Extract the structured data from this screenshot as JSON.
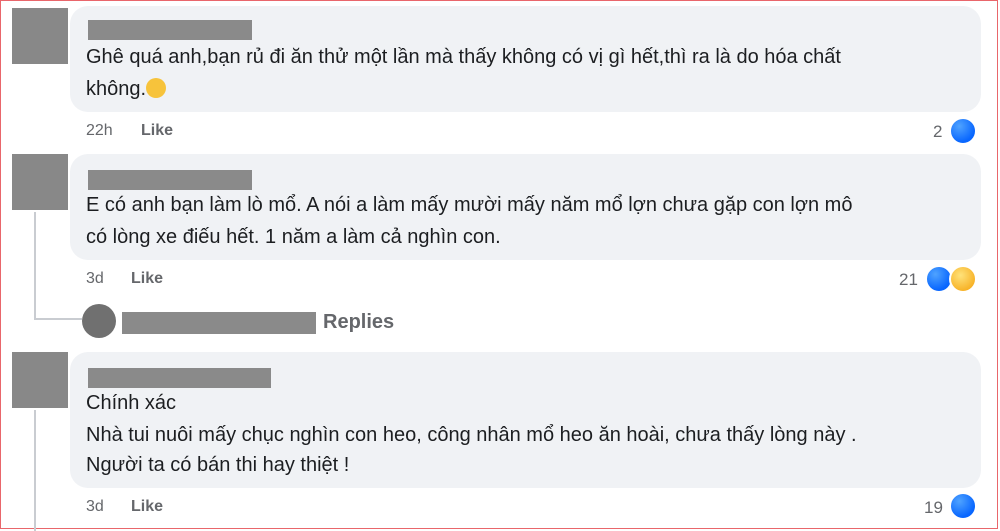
{
  "comments": [
    {
      "text_line1": "Ghê quá anh,bạn rủ đi ăn thử một lần mà thấy không có vị gì hết,thì ra là do hóa chất",
      "text_line2": "không.",
      "time": "22h",
      "like_label": "Like",
      "reaction_count": "2",
      "reactions": [
        "like-icon"
      ]
    },
    {
      "text_line1": "E có anh bạn làm lò mổ. A nói a làm mấy mười mấy năm mổ lợn chưa gặp con lợn mô",
      "text_line2": "có lòng xe điếu hết. 1 năm a làm cả nghìn con.",
      "time": "3d",
      "like_label": "Like",
      "reaction_count": "21",
      "reactions": [
        "like-icon",
        "haha-icon"
      ]
    },
    {
      "text_line1": "Chính xác",
      "text_line2": "Nhà tui nuôi mấy chục nghìn con heo, công nhân mổ heo ăn hoài, chưa thấy lòng này .",
      "text_line3": "Người ta có bán thi hay thiệt !",
      "time": "3d",
      "like_label": "Like",
      "reaction_count": "19",
      "reactions": [
        "like-icon"
      ]
    }
  ],
  "replies_label": "Replies",
  "colors": {
    "like_blue": "#0866ff",
    "bubble_bg": "#f0f2f5",
    "meta_gray": "#65676b"
  }
}
